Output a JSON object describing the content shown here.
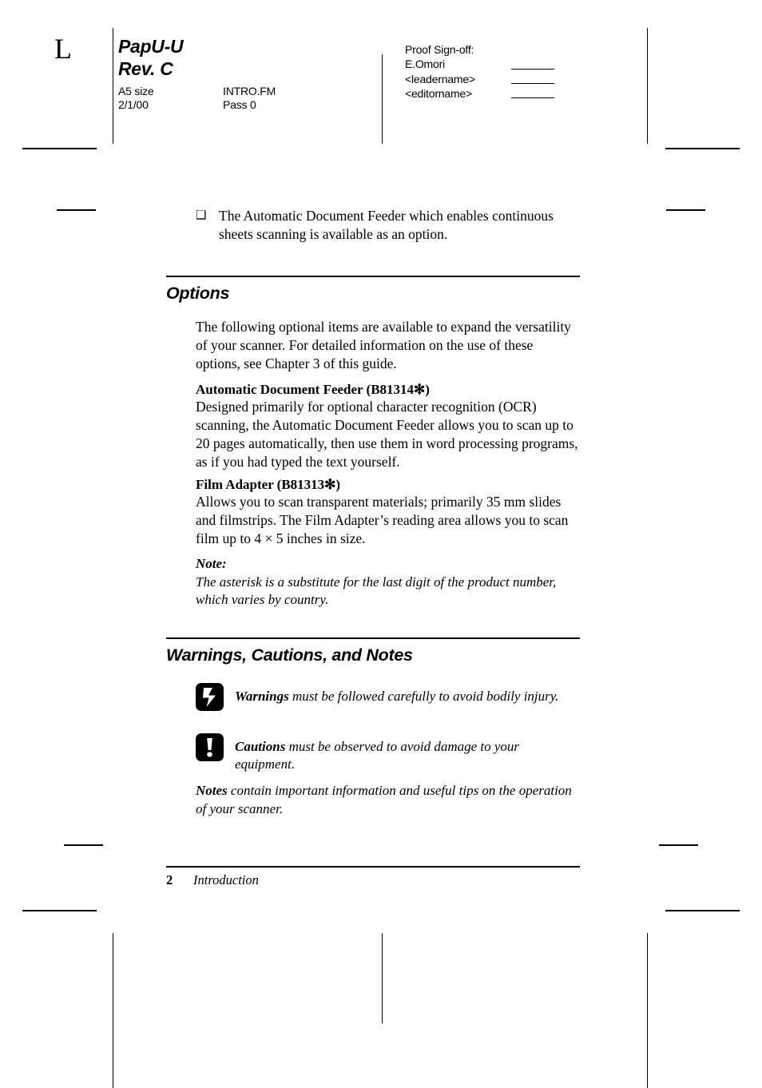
{
  "header": {
    "sheet_mark": "L",
    "job_title_line1": "PapU-U",
    "job_title_line2": "Rev. C",
    "paper_size": "A5 size",
    "file_name": "INTRO.FM",
    "date": "2/1/00",
    "pass": "Pass 0",
    "signoff": {
      "title": "Proof Sign-off:",
      "names": [
        "E.Omori",
        "<leadername>",
        "<editorname>"
      ]
    }
  },
  "body": {
    "bullet": {
      "glyph": "❑",
      "text": "The Automatic Document Feeder which enables continuous sheets scanning is available as an option."
    },
    "options": {
      "heading": "Options",
      "intro": "The following optional items are available to expand the versatility of your scanner. For detailed information on the use of these options, see Chapter 3 of this guide.",
      "items": [
        {
          "title": "Automatic Document Feeder (B81314✻)",
          "text": "Designed primarily for optional character recognition (OCR) scanning, the Automatic Document Feeder allows you to scan up to 20 pages automatically, then use them in word processing programs, as if you had typed the text yourself."
        },
        {
          "title": "Film Adapter (B81313✻)",
          "text": "Allows you to scan transparent materials; primarily 35 mm slides and filmstrips. The Film Adapter’s reading area allows you to scan film up to 4 × 5 inches in size."
        }
      ],
      "note_label": "Note:",
      "note_text": "The asterisk is a substitute for the last digit of the product number, which varies by country."
    },
    "admonitions": {
      "heading": "Warnings, Cautions, and Notes",
      "warning": {
        "label": "Warnings",
        "text": " must be followed carefully to avoid bodily injury."
      },
      "caution": {
        "label": "Cautions",
        "text": " must be observed to avoid damage to your equipment."
      },
      "note": {
        "label": "Notes",
        "text": " contain important information and useful tips on the operation of your scanner."
      }
    }
  },
  "footer": {
    "page_number": "2",
    "chapter": "Introduction"
  }
}
